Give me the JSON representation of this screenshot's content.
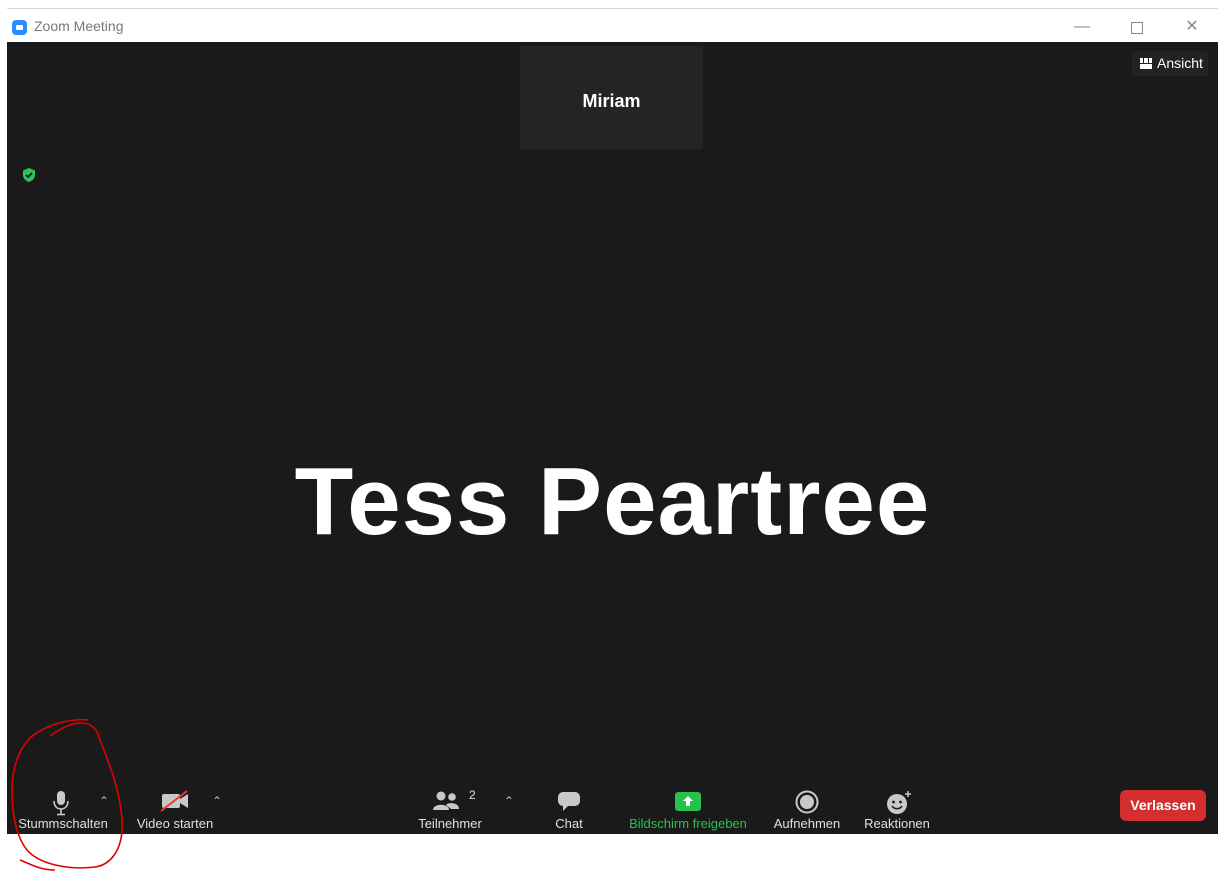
{
  "window": {
    "title": "Zoom Meeting"
  },
  "thumbnail": {
    "name": "Miriam"
  },
  "view_button": {
    "label": "Ansicht"
  },
  "speaker": {
    "name": "Tess Peartree"
  },
  "toolbar": {
    "mute_label": "Stummschalten",
    "video_label": "Video starten",
    "participants_label": "Teilnehmer",
    "participants_count": "2",
    "chat_label": "Chat",
    "share_label": "Bildschirm freigeben",
    "record_label": "Aufnehmen",
    "reactions_label": "Reaktionen",
    "leave_label": "Verlassen"
  },
  "colors": {
    "accent": "#2d8cff",
    "share_green": "#27c24c",
    "leave_red": "#d32f2f",
    "annotation": "#e00000"
  },
  "icons": [
    "zoom-app-icon",
    "minimize-icon",
    "maximize-icon",
    "close-icon",
    "grid-view-icon",
    "security-shield-icon",
    "microphone-icon",
    "video-off-icon",
    "participants-icon",
    "chat-icon",
    "share-screen-icon",
    "record-icon",
    "reactions-icon",
    "chevron-up-icon"
  ]
}
